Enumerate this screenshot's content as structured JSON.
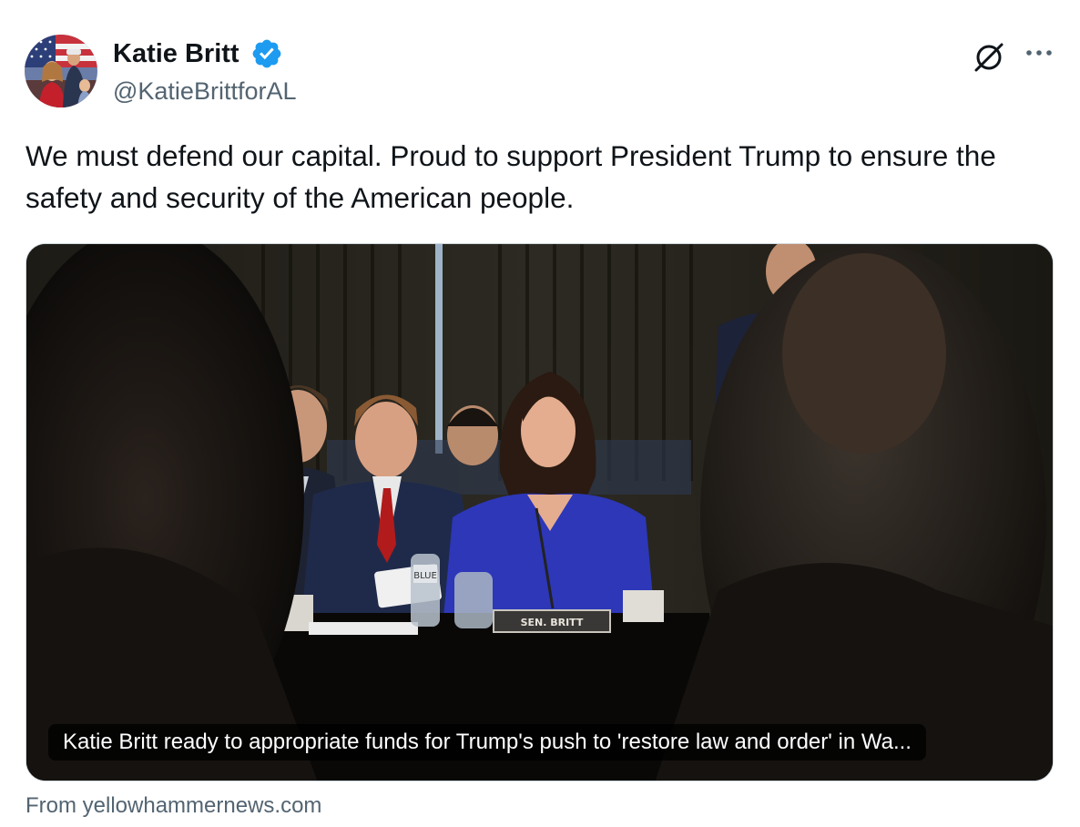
{
  "author": {
    "display_name": "Katie Britt",
    "handle": "@KatieBrittforAL",
    "verified": true,
    "avatar_icon": "profile-photo"
  },
  "post": {
    "text": "We must defend our capital. Proud to support President Trump to ensure the safety and security of the American people."
  },
  "header_actions": {
    "grok_icon": "grok-icon",
    "more_icon": "more-dots-icon"
  },
  "link_card": {
    "caption": "Katie Britt ready to appropriate funds for Trump's push to 'restore law and order' in Wa...",
    "nameplate": "SEN. BRITT",
    "bottle_label": "BLUE",
    "source": "From yellowhammernews.com"
  },
  "colors": {
    "text_primary": "#0f1419",
    "text_secondary": "#536471",
    "verified_blue": "#1d9bf0",
    "card_border": "#cfd9de"
  }
}
